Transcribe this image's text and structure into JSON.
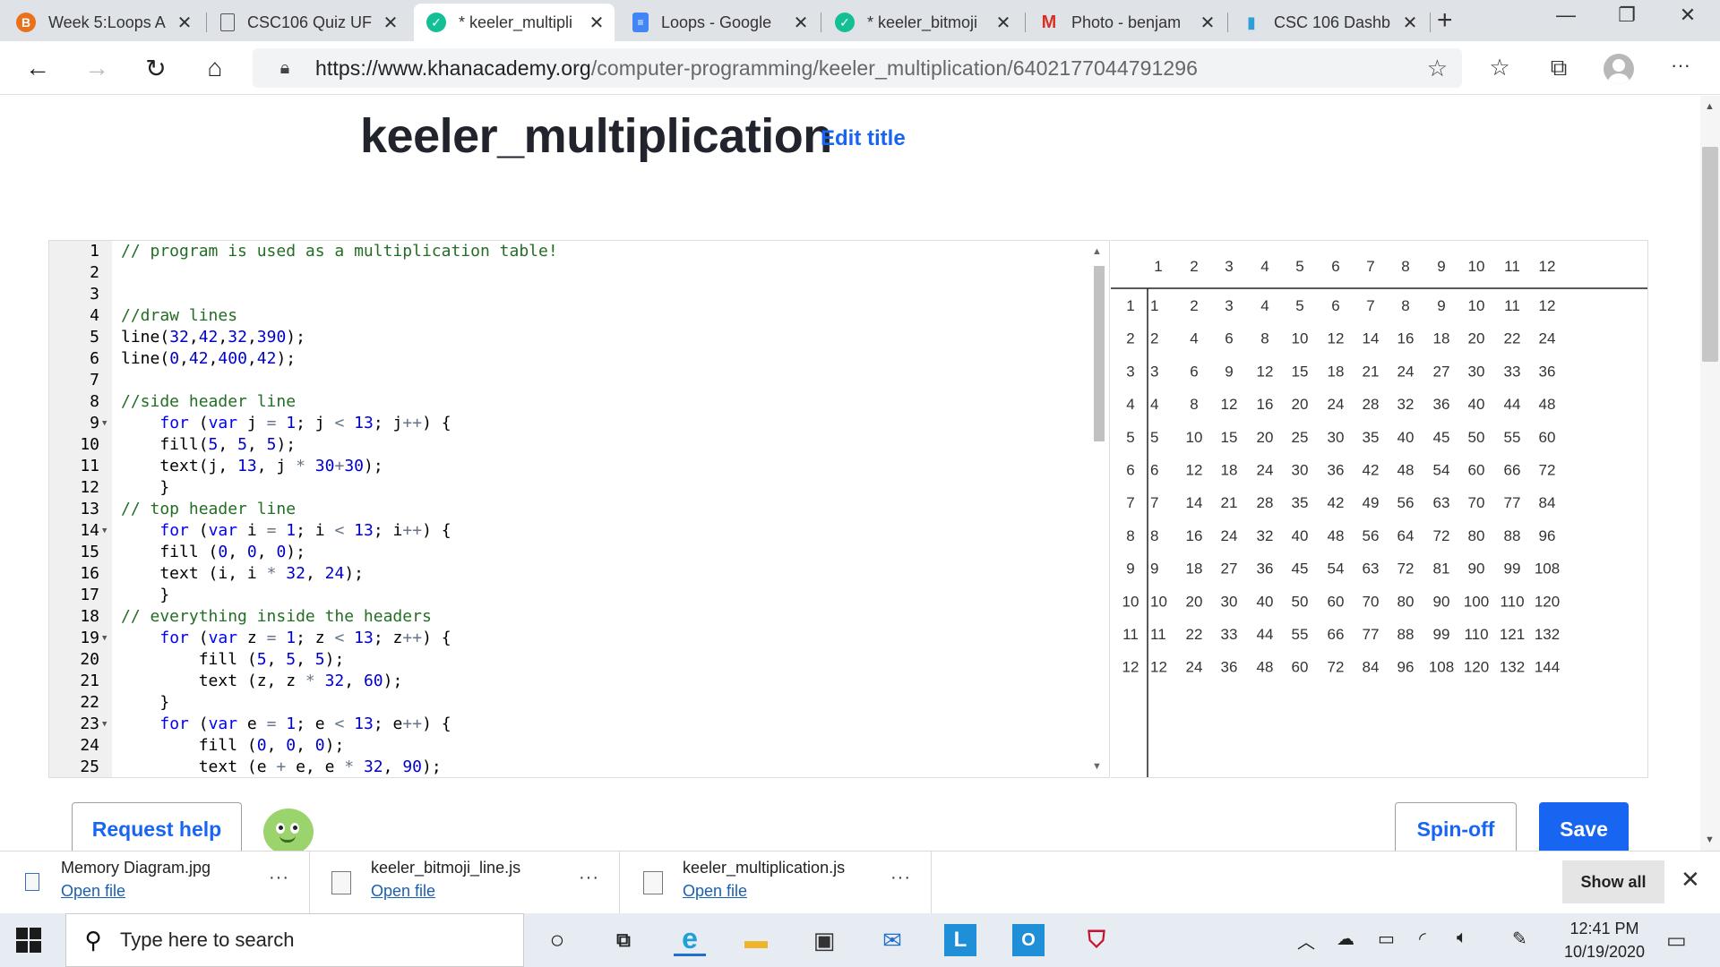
{
  "tabs": [
    {
      "title": "Week 5:Loops A",
      "icon": "brand-b-icon",
      "icon_color": "#e9711c",
      "active": false
    },
    {
      "title": "CSC106 Quiz UF",
      "icon": "document-icon",
      "icon_color": "#555555",
      "active": false
    },
    {
      "title": "* keeler_multipli",
      "icon": "khan-academy-icon",
      "icon_color": "#14bf96",
      "active": true
    },
    {
      "title": "Loops - Google",
      "icon": "google-docs-icon",
      "icon_color": "#4285f4",
      "active": false
    },
    {
      "title": "* keeler_bitmoji",
      "icon": "khan-academy-icon",
      "icon_color": "#14bf96",
      "active": false
    },
    {
      "title": "Photo - benjam",
      "icon": "gmail-icon",
      "icon_color": "#d93025",
      "active": false
    },
    {
      "title": "CSC 106 Dashb",
      "icon": "bar-chart-icon",
      "icon_color": "#2f9fd8",
      "active": false
    }
  ],
  "address": {
    "url_prefix": "https://www.khanacademy.org",
    "url_path": "/computer-programming/keeler_multiplication/6402177044791296"
  },
  "page": {
    "title": "keeler_multiplication",
    "edit_title": "Edit title"
  },
  "code_lines": [
    {
      "n": 1,
      "fold": false,
      "tokens": [
        [
          "c",
          "// program is used as a multiplication table!"
        ]
      ]
    },
    {
      "n": 2,
      "fold": false,
      "tokens": []
    },
    {
      "n": 3,
      "fold": false,
      "tokens": []
    },
    {
      "n": 4,
      "fold": false,
      "tokens": [
        [
          "c",
          "//draw lines"
        ]
      ]
    },
    {
      "n": 5,
      "fold": false,
      "tokens": [
        [
          "t",
          "line("
        ],
        [
          "n",
          "32"
        ],
        [
          "t",
          ","
        ],
        [
          "n",
          "42"
        ],
        [
          "t",
          ","
        ],
        [
          "n",
          "32"
        ],
        [
          "t",
          ","
        ],
        [
          "n",
          "390"
        ],
        [
          "t",
          ");"
        ]
      ]
    },
    {
      "n": 6,
      "fold": false,
      "tokens": [
        [
          "t",
          "line("
        ],
        [
          "n",
          "0"
        ],
        [
          "t",
          ","
        ],
        [
          "n",
          "42"
        ],
        [
          "t",
          ","
        ],
        [
          "n",
          "400"
        ],
        [
          "t",
          ","
        ],
        [
          "n",
          "42"
        ],
        [
          "t",
          ");"
        ]
      ]
    },
    {
      "n": 7,
      "fold": false,
      "tokens": []
    },
    {
      "n": 8,
      "fold": false,
      "tokens": [
        [
          "c",
          "//side header line"
        ]
      ]
    },
    {
      "n": 9,
      "fold": true,
      "tokens": [
        [
          "t",
          "    "
        ],
        [
          "k",
          "for"
        ],
        [
          "t",
          " ("
        ],
        [
          "k",
          "var"
        ],
        [
          "t",
          " j "
        ],
        [
          "o",
          "="
        ],
        [
          "t",
          " "
        ],
        [
          "n",
          "1"
        ],
        [
          "t",
          "; j "
        ],
        [
          "o",
          "<"
        ],
        [
          "t",
          " "
        ],
        [
          "n",
          "13"
        ],
        [
          "t",
          "; j"
        ],
        [
          "o",
          "++"
        ],
        [
          "t",
          ") {"
        ]
      ]
    },
    {
      "n": 10,
      "fold": false,
      "tokens": [
        [
          "t",
          "    fill("
        ],
        [
          "n",
          "5"
        ],
        [
          "t",
          ", "
        ],
        [
          "n",
          "5"
        ],
        [
          "t",
          ", "
        ],
        [
          "n",
          "5"
        ],
        [
          "t",
          ");"
        ]
      ]
    },
    {
      "n": 11,
      "fold": false,
      "tokens": [
        [
          "t",
          "    text(j, "
        ],
        [
          "n",
          "13"
        ],
        [
          "t",
          ", j "
        ],
        [
          "o",
          "*"
        ],
        [
          "t",
          " "
        ],
        [
          "n",
          "30"
        ],
        [
          "o",
          "+"
        ],
        [
          "n",
          "30"
        ],
        [
          "t",
          ");"
        ]
      ]
    },
    {
      "n": 12,
      "fold": false,
      "tokens": [
        [
          "t",
          "    }"
        ]
      ]
    },
    {
      "n": 13,
      "fold": false,
      "tokens": [
        [
          "c",
          "// top header line"
        ]
      ]
    },
    {
      "n": 14,
      "fold": true,
      "tokens": [
        [
          "t",
          "    "
        ],
        [
          "k",
          "for"
        ],
        [
          "t",
          " ("
        ],
        [
          "k",
          "var"
        ],
        [
          "t",
          " i "
        ],
        [
          "o",
          "="
        ],
        [
          "t",
          " "
        ],
        [
          "n",
          "1"
        ],
        [
          "t",
          "; i "
        ],
        [
          "o",
          "<"
        ],
        [
          "t",
          " "
        ],
        [
          "n",
          "13"
        ],
        [
          "t",
          "; i"
        ],
        [
          "o",
          "++"
        ],
        [
          "t",
          ") {"
        ]
      ]
    },
    {
      "n": 15,
      "fold": false,
      "tokens": [
        [
          "t",
          "    fill ("
        ],
        [
          "n",
          "0"
        ],
        [
          "t",
          ", "
        ],
        [
          "n",
          "0"
        ],
        [
          "t",
          ", "
        ],
        [
          "n",
          "0"
        ],
        [
          "t",
          ");"
        ]
      ]
    },
    {
      "n": 16,
      "fold": false,
      "tokens": [
        [
          "t",
          "    text (i, i "
        ],
        [
          "o",
          "*"
        ],
        [
          "t",
          " "
        ],
        [
          "n",
          "32"
        ],
        [
          "t",
          ", "
        ],
        [
          "n",
          "24"
        ],
        [
          "t",
          ");"
        ]
      ]
    },
    {
      "n": 17,
      "fold": false,
      "tokens": [
        [
          "t",
          "    }"
        ]
      ]
    },
    {
      "n": 18,
      "fold": false,
      "tokens": [
        [
          "c",
          "// everything inside the headers"
        ]
      ]
    },
    {
      "n": 19,
      "fold": true,
      "tokens": [
        [
          "t",
          "    "
        ],
        [
          "k",
          "for"
        ],
        [
          "t",
          " ("
        ],
        [
          "k",
          "var"
        ],
        [
          "t",
          " z "
        ],
        [
          "o",
          "="
        ],
        [
          "t",
          " "
        ],
        [
          "n",
          "1"
        ],
        [
          "t",
          "; z "
        ],
        [
          "o",
          "<"
        ],
        [
          "t",
          " "
        ],
        [
          "n",
          "13"
        ],
        [
          "t",
          "; z"
        ],
        [
          "o",
          "++"
        ],
        [
          "t",
          ") {"
        ]
      ]
    },
    {
      "n": 20,
      "fold": false,
      "tokens": [
        [
          "t",
          "        fill ("
        ],
        [
          "n",
          "5"
        ],
        [
          "t",
          ", "
        ],
        [
          "n",
          "5"
        ],
        [
          "t",
          ", "
        ],
        [
          "n",
          "5"
        ],
        [
          "t",
          ");"
        ]
      ]
    },
    {
      "n": 21,
      "fold": false,
      "tokens": [
        [
          "t",
          "        text (z, z "
        ],
        [
          "o",
          "*"
        ],
        [
          "t",
          " "
        ],
        [
          "n",
          "32"
        ],
        [
          "t",
          ", "
        ],
        [
          "n",
          "60"
        ],
        [
          "t",
          ");"
        ]
      ]
    },
    {
      "n": 22,
      "fold": false,
      "tokens": [
        [
          "t",
          "    }"
        ]
      ]
    },
    {
      "n": 23,
      "fold": true,
      "tokens": [
        [
          "t",
          "    "
        ],
        [
          "k",
          "for"
        ],
        [
          "t",
          " ("
        ],
        [
          "k",
          "var"
        ],
        [
          "t",
          " e "
        ],
        [
          "o",
          "="
        ],
        [
          "t",
          " "
        ],
        [
          "n",
          "1"
        ],
        [
          "t",
          "; e "
        ],
        [
          "o",
          "<"
        ],
        [
          "t",
          " "
        ],
        [
          "n",
          "13"
        ],
        [
          "t",
          "; e"
        ],
        [
          "o",
          "++"
        ],
        [
          "t",
          ") {"
        ]
      ]
    },
    {
      "n": 24,
      "fold": false,
      "tokens": [
        [
          "t",
          "        fill ("
        ],
        [
          "n",
          "0"
        ],
        [
          "t",
          ", "
        ],
        [
          "n",
          "0"
        ],
        [
          "t",
          ", "
        ],
        [
          "n",
          "0"
        ],
        [
          "t",
          ");"
        ]
      ]
    },
    {
      "n": 25,
      "fold": false,
      "tokens": [
        [
          "t",
          "        text (e "
        ],
        [
          "o",
          "+"
        ],
        [
          "t",
          " e, e "
        ],
        [
          "o",
          "*"
        ],
        [
          "t",
          " "
        ],
        [
          "n",
          "32"
        ],
        [
          "t",
          ", "
        ],
        [
          "n",
          "90"
        ],
        [
          "t",
          ");"
        ]
      ]
    }
  ],
  "output": {
    "header_row": [
      "1",
      "2",
      "3",
      "4",
      "5",
      "6",
      "7",
      "8",
      "9",
      "10",
      "11",
      "12"
    ],
    "rows": [
      {
        "label": "1",
        "lead": "1",
        "values": [
          "2",
          "3",
          "4",
          "5",
          "6",
          "7",
          "8",
          "9",
          "10",
          "11",
          "12"
        ]
      },
      {
        "label": "2",
        "lead": "2",
        "values": [
          "4",
          "6",
          "8",
          "10",
          "12",
          "14",
          "16",
          "18",
          "20",
          "22",
          "24"
        ]
      },
      {
        "label": "3",
        "lead": "3",
        "values": [
          "6",
          "9",
          "12",
          "15",
          "18",
          "21",
          "24",
          "27",
          "30",
          "33",
          "36"
        ]
      },
      {
        "label": "4",
        "lead": "4",
        "values": [
          "8",
          "12",
          "16",
          "20",
          "24",
          "28",
          "32",
          "36",
          "40",
          "44",
          "48"
        ]
      },
      {
        "label": "5",
        "lead": "5",
        "values": [
          "10",
          "15",
          "20",
          "25",
          "30",
          "35",
          "40",
          "45",
          "50",
          "55",
          "60"
        ]
      },
      {
        "label": "6",
        "lead": "6",
        "values": [
          "12",
          "18",
          "24",
          "30",
          "36",
          "42",
          "48",
          "54",
          "60",
          "66",
          "72"
        ]
      },
      {
        "label": "7",
        "lead": "7",
        "values": [
          "14",
          "21",
          "28",
          "35",
          "42",
          "49",
          "56",
          "63",
          "70",
          "77",
          "84"
        ]
      },
      {
        "label": "8",
        "lead": "8",
        "values": [
          "16",
          "24",
          "32",
          "40",
          "48",
          "56",
          "64",
          "72",
          "80",
          "88",
          "96"
        ]
      },
      {
        "label": "9",
        "lead": "9",
        "values": [
          "18",
          "27",
          "36",
          "45",
          "54",
          "63",
          "72",
          "81",
          "90",
          "99",
          "108"
        ]
      },
      {
        "label": "10",
        "lead": "10",
        "values": [
          "20",
          "30",
          "40",
          "50",
          "60",
          "70",
          "80",
          "90",
          "100",
          "110",
          "120"
        ]
      },
      {
        "label": "11",
        "lead": "11",
        "values": [
          "22",
          "33",
          "44",
          "55",
          "66",
          "77",
          "88",
          "99",
          "110",
          "121",
          "132"
        ]
      },
      {
        "label": "12",
        "lead": "12",
        "values": [
          "24",
          "36",
          "48",
          "60",
          "72",
          "84",
          "96",
          "108",
          "120",
          "132",
          "144"
        ]
      }
    ]
  },
  "actions": {
    "request_help": "Request help",
    "spinoff": "Spin-off",
    "save": "Save"
  },
  "downloads": [
    {
      "name": "Memory Diagram.jpg",
      "open": "Open file"
    },
    {
      "name": "keeler_bitmoji_line.js",
      "open": "Open file"
    },
    {
      "name": "keeler_multiplication.js",
      "open": "Open file"
    }
  ],
  "downloads_show_all": "Show all",
  "taskbar": {
    "search_placeholder": "Type here to search",
    "time": "12:41 PM",
    "date": "10/19/2020"
  },
  "colors": {
    "accent": "#1865f2",
    "editor_gutter": "#f0f0f0",
    "code_comment": "#236e25",
    "code_keyword": "#0000ff",
    "code_number": "#0000cd"
  }
}
